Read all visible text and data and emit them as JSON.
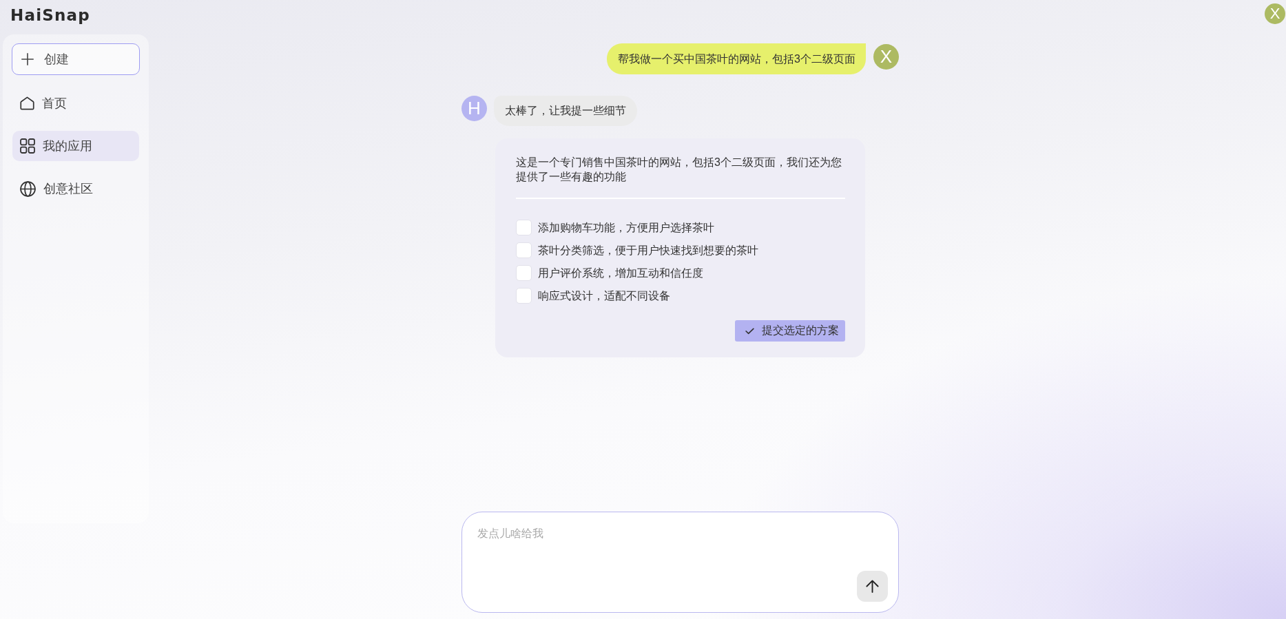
{
  "header": {
    "logo": "HaiSnap",
    "user_avatar": "X"
  },
  "sidebar": {
    "create_button": "创建",
    "items": [
      {
        "kind": "home",
        "label": "首页",
        "selected": false
      },
      {
        "kind": "apps",
        "label": "我的应用",
        "selected": true
      },
      {
        "kind": "community",
        "label": "创意社区",
        "selected": false
      }
    ]
  },
  "chat": {
    "messages": [
      {
        "kind": "user",
        "avatar": "X",
        "text": "帮我做一个买中国茶叶的网站，包括3个二级页面"
      },
      {
        "kind": "assistant",
        "avatar": "H",
        "text": "太棒了，让我提一些细节"
      }
    ],
    "option_card": {
      "description": "这是一个专门销售中国茶叶的网站，包括3个二级页面，我们还为您提供了一些有趣的功能",
      "options": [
        {
          "label": "添加购物车功能，方便用户选择茶叶",
          "checked": false
        },
        {
          "label": "茶叶分类筛选，便于用户快速找到想要的茶叶",
          "checked": false
        },
        {
          "label": "用户评价系统，增加互动和信任度",
          "checked": false
        },
        {
          "label": "响应式设计，适配不同设备",
          "checked": false
        }
      ],
      "submit_button": "提交选定的方案"
    }
  },
  "composer": {
    "placeholder": "发点儿啥给我"
  }
}
